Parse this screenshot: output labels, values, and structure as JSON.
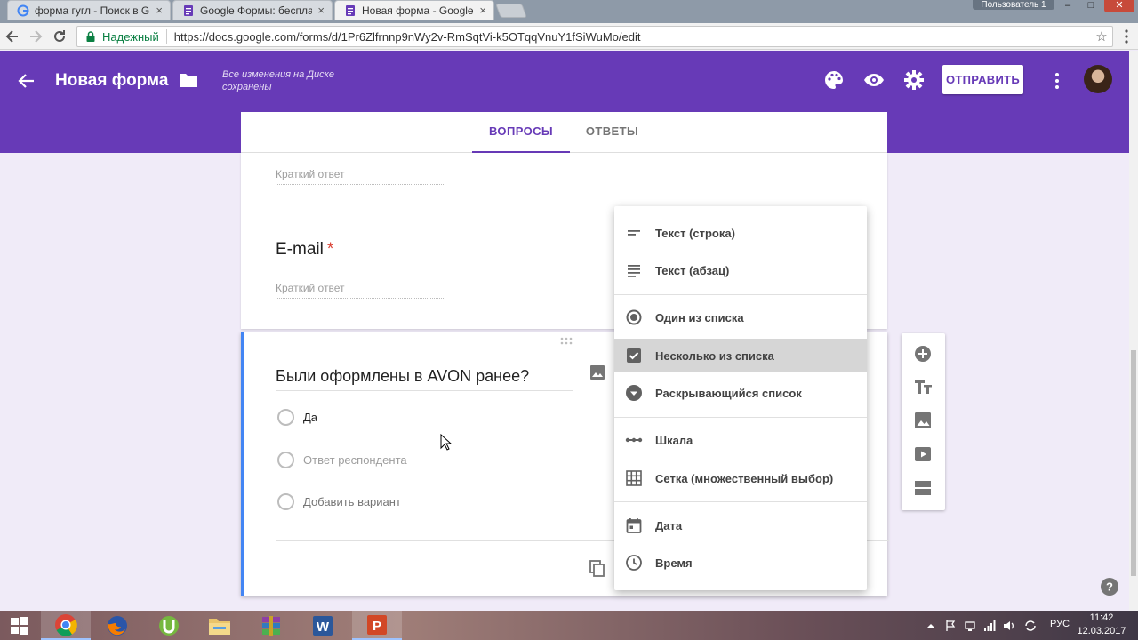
{
  "browser": {
    "tabs": [
      {
        "title": "форма гугл - Поиск в G",
        "close": "×"
      },
      {
        "title": "Google Формы: бесплат",
        "close": "×"
      },
      {
        "title": "Новая форма - Google",
        "close": "×"
      }
    ],
    "user_label": "Пользователь 1",
    "window_buttons": {
      "minimize": "–",
      "maximize": "□",
      "close": "✕"
    },
    "secure_label": "Надежный",
    "url": "https://docs.google.com/forms/d/1Pr6Zlfrnnp9nWy2v-RmSqtVi-k5OTqqVnuY1fSiWuMo/edit"
  },
  "header": {
    "title": "Новая форма",
    "save_status": "Все изменения на Диске сохранены",
    "send_label": "ОТПРАВИТЬ"
  },
  "form_tabs": {
    "questions": "ВОПРОСЫ",
    "answers": "ОТВЕТЫ"
  },
  "card1": {
    "short_answer_top": "Краткий ответ",
    "email_title": "E-mail",
    "required_mark": "*",
    "short_answer": "Краткий ответ"
  },
  "card2": {
    "question_title": "Были оформлены в AVON ранее?",
    "options": [
      "Да",
      "Ответ респондента",
      "Добавить вариант"
    ]
  },
  "type_menu": {
    "items": [
      {
        "label": "Текст (строка)",
        "icon": "short-text-icon"
      },
      {
        "label": "Текст (абзац)",
        "icon": "paragraph-icon"
      },
      {
        "label": "Один из списка",
        "icon": "radio-icon"
      },
      {
        "label": "Несколько из списка",
        "icon": "checkbox-icon",
        "selected": true
      },
      {
        "label": "Раскрывающийся список",
        "icon": "dropdown-icon"
      },
      {
        "label": "Шкала",
        "icon": "linear-scale-icon"
      },
      {
        "label": "Сетка (множественный выбор)",
        "icon": "grid-icon"
      },
      {
        "label": "Дата",
        "icon": "calendar-icon"
      },
      {
        "label": "Время",
        "icon": "clock-icon"
      }
    ]
  },
  "taskbar": {
    "apps": [
      "windows-start",
      "chrome",
      "firefox",
      "utorrent",
      "file-explorer",
      "winrar",
      "word",
      "powerpoint"
    ],
    "language": "РУС",
    "time": "11:42",
    "date": "12.03.2017"
  },
  "colors": {
    "brand": "#673ab7",
    "accent": "#4285f4",
    "required": "#db4437"
  }
}
